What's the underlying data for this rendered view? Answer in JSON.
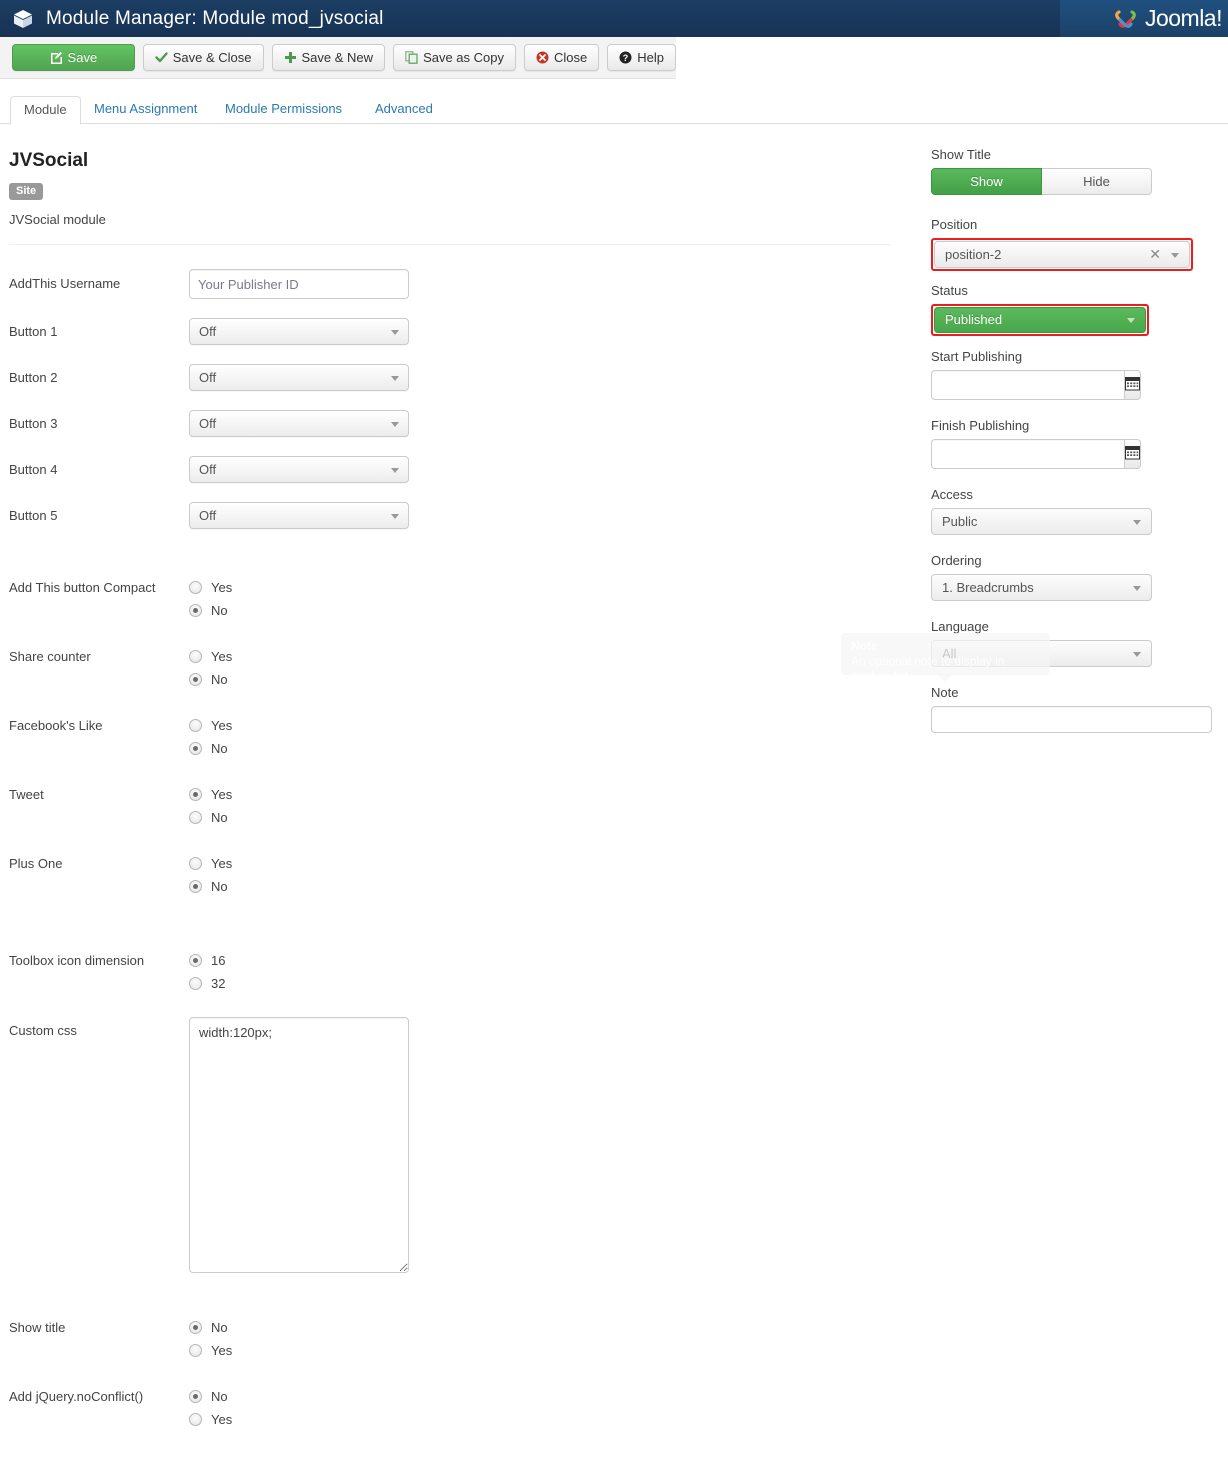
{
  "header": {
    "icon": "cube-icon",
    "title": "Module Manager: Module mod_jvsocial",
    "brand": "Joomla!"
  },
  "toolbar": {
    "save": "Save",
    "save_close": "Save & Close",
    "save_new": "Save & New",
    "save_copy": "Save as Copy",
    "close": "Close",
    "help": "Help"
  },
  "tabs": [
    {
      "label": "Module",
      "active": true
    },
    {
      "label": "Menu Assignment",
      "active": false
    },
    {
      "label": "Module Permissions",
      "active": false
    },
    {
      "label": "Advanced",
      "active": false
    }
  ],
  "module": {
    "name": "JVSocial",
    "badge": "Site",
    "description": "JVSocial module"
  },
  "fields": {
    "addthis_username": {
      "label": "AddThis Username",
      "value": "",
      "placeholder": "Your Publisher ID"
    },
    "button1": {
      "label": "Button 1",
      "value": "Off"
    },
    "button2": {
      "label": "Button 2",
      "value": "Off"
    },
    "button3": {
      "label": "Button 3",
      "value": "Off"
    },
    "button4": {
      "label": "Button 4",
      "value": "Off"
    },
    "button5": {
      "label": "Button 5",
      "value": "Off"
    },
    "compact": {
      "label": "Add This button Compact",
      "options": [
        "Yes",
        "No"
      ],
      "selected": "No"
    },
    "share_counter": {
      "label": "Share counter",
      "options": [
        "Yes",
        "No"
      ],
      "selected": "No"
    },
    "facebook_like": {
      "label": "Facebook's Like",
      "options": [
        "Yes",
        "No"
      ],
      "selected": "No"
    },
    "tweet": {
      "label": "Tweet",
      "options": [
        "Yes",
        "No"
      ],
      "selected": "Yes"
    },
    "plus_one": {
      "label": "Plus One",
      "options": [
        "Yes",
        "No"
      ],
      "selected": "No"
    },
    "toolbox_dimension": {
      "label": "Toolbox icon dimension",
      "options": [
        "16",
        "32"
      ],
      "selected": "16"
    },
    "custom_css": {
      "label": "Custom css",
      "value": "width:120px;"
    },
    "show_title_bottom": {
      "label": "Show title",
      "options": [
        "No",
        "Yes"
      ],
      "selected": "No"
    },
    "jquery_noconflict": {
      "label": "Add jQuery.noConflict()",
      "options": [
        "No",
        "Yes"
      ],
      "selected": "No"
    }
  },
  "sidebar": {
    "show_title": {
      "label": "Show Title",
      "options": [
        "Show",
        "Hide"
      ],
      "selected": "Show"
    },
    "position": {
      "label": "Position",
      "value": "position-2",
      "highlighted": true
    },
    "status": {
      "label": "Status",
      "value": "Published",
      "highlighted": true
    },
    "start_publishing": {
      "label": "Start Publishing",
      "value": "",
      "icon": "calendar-icon"
    },
    "finish_publishing": {
      "label": "Finish Publishing",
      "value": "",
      "icon": "calendar-icon"
    },
    "access": {
      "label": "Access",
      "value": "Public"
    },
    "ordering": {
      "label": "Ordering",
      "value": "1. Breadcrumbs"
    },
    "language": {
      "label": "Language",
      "value": "All"
    },
    "note": {
      "label": "Note",
      "value": ""
    }
  },
  "tooltip": {
    "title": "Note",
    "body": "An optional note to display in module list"
  },
  "colors": {
    "header_bg": "#1c3d63",
    "accent_green": "#51a351",
    "highlight_red": "#ee1c1c",
    "link_blue": "#2a7ab0"
  }
}
